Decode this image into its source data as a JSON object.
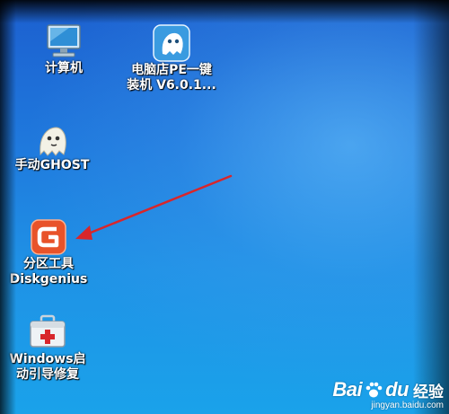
{
  "desktop": {
    "icons": [
      {
        "label": "计算机"
      },
      {
        "label_line1": "电脑店PE一键",
        "label_line2": "装机 V6.0.1..."
      },
      {
        "label": "手动GHOST"
      },
      {
        "label_line1": "分区工具",
        "label_line2": "Diskgenius"
      },
      {
        "label_line1": "Windows启",
        "label_line2": "动引导修复"
      }
    ]
  },
  "watermark": {
    "brand": "Bai",
    "brand_end": "du",
    "suffix": "经验",
    "url": "jingyan.baidu.com"
  },
  "colors": {
    "desktop_blue": "#1f79dd",
    "arrow_red": "#d8262b",
    "diskgenius_orange": "#e8532a"
  }
}
